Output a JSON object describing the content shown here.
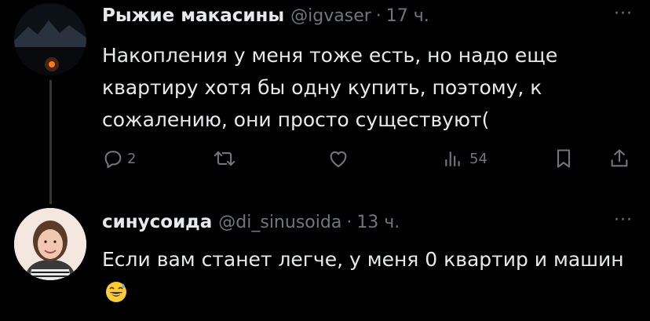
{
  "tweet1": {
    "author_name": "Рыжие макасины",
    "handle": "@igvaser",
    "separator": "·",
    "time": "17 ч.",
    "more": "···",
    "text": "Накопления у меня тоже есть, но надо еще квартиру хотя бы одну купить, поэтому, к сожалению, они просто существуют(",
    "replies": "2",
    "views": "54"
  },
  "tweet2": {
    "author_name": "синусоида",
    "handle": "@di_sinusoida",
    "separator": "·",
    "time": "13 ч.",
    "more": "···",
    "text": "Если вам станет легче, у меня 0 квартир и машин",
    "emoji": "grinning-face-with-sweat"
  },
  "colors": {
    "background": "#000000",
    "text_primary": "#e7e9ea",
    "text_secondary": "#71767b",
    "thread_line": "#333639"
  }
}
